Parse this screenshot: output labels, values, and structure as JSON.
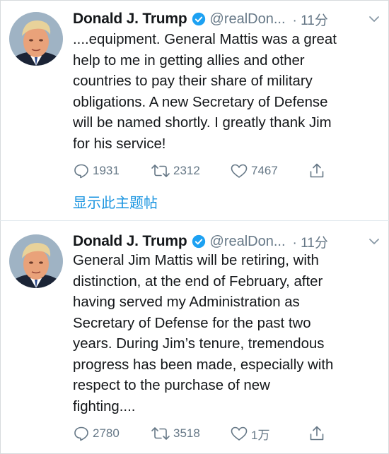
{
  "tweets": [
    {
      "name": "Donald J. Trump",
      "handle": "@realDon...",
      "time": "· 11分",
      "text_lines": [
        "....equipment. General Mattis was a great",
        "help to me in getting allies and other",
        "countries to pay their share of military",
        "obligations. A new Secretary of Defense",
        "will be named shortly. I greatly thank Jim",
        "for his service!"
      ],
      "replies": "1931",
      "retweets": "2312",
      "likes": "7467",
      "thread_link": "显示此主题帖"
    },
    {
      "name": "Donald J. Trump",
      "handle": "@realDon...",
      "time": "· 11分",
      "text_lines": [
        "General Jim Mattis will be retiring, with",
        "distinction, at the end of February, after",
        "having served my Administration as",
        "Secretary of Defense for the past two",
        "years. During Jim’s tenure, tremendous",
        "progress has been made, especially with",
        "respect to the purchase of new",
        "fighting...."
      ],
      "replies": "2780",
      "retweets": "3518",
      "likes": "1万"
    }
  ],
  "colors": {
    "verified": "#1da1f2",
    "link": "#1b95e0",
    "secondary_text": "#657786",
    "icon": "#657786"
  },
  "icons": [
    "verified-badge-icon",
    "chevron-down-icon",
    "reply-icon",
    "retweet-icon",
    "like-icon",
    "share-icon"
  ]
}
